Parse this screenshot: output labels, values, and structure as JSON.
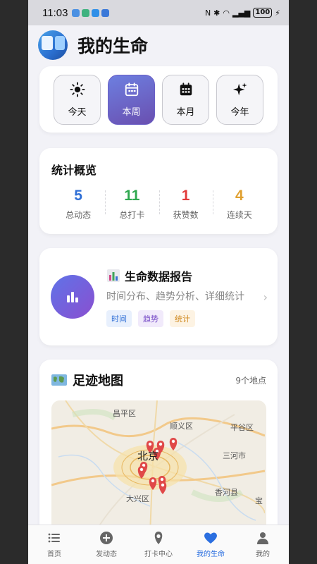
{
  "status_bar": {
    "time": "11:03",
    "battery": "100"
  },
  "header": {
    "title": "我的生命"
  },
  "periods": [
    {
      "label": "今天",
      "icon": "sun-icon",
      "active": false
    },
    {
      "label": "本周",
      "icon": "calendar-icon",
      "active": true
    },
    {
      "label": "本月",
      "icon": "calendar-grid-icon",
      "active": false
    },
    {
      "label": "今年",
      "icon": "sparkles-icon",
      "active": false
    }
  ],
  "stats": {
    "title": "统计概览",
    "items": [
      {
        "value": "5",
        "label": "总动态",
        "color": "#2f6fd6"
      },
      {
        "value": "11",
        "label": "总打卡",
        "color": "#2fa84f"
      },
      {
        "value": "1",
        "label": "获赞数",
        "color": "#e23b3b"
      },
      {
        "value": "4",
        "label": "连续天",
        "color": "#e0a030"
      }
    ]
  },
  "report": {
    "icon": "bar-chart-icon",
    "title": "生命数据报告",
    "description": "时间分布、趋势分析、详细统计",
    "tags": [
      {
        "label": "时间",
        "color": "#2f6fd6",
        "bg": "#e8f0fd"
      },
      {
        "label": "趋势",
        "color": "#7a4fc8",
        "bg": "#f1eafb"
      },
      {
        "label": "统计",
        "color": "#d08a20",
        "bg": "#fdf3e3"
      }
    ]
  },
  "map": {
    "title": "足迹地图",
    "count": "9个地点",
    "labels": {
      "changping": "昌平区",
      "shunyi": "顺义区",
      "pinggu": "平谷区",
      "beijing": "北京",
      "sanhe": "三河市",
      "xianghe": "香河县",
      "daxing": "大兴区",
      "bao": "宝"
    }
  },
  "tabbar": [
    {
      "label": "首页",
      "icon": "list-icon",
      "active": false
    },
    {
      "label": "发动态",
      "icon": "add-circle-icon",
      "active": false
    },
    {
      "label": "打卡中心",
      "icon": "location-pin-icon",
      "active": false
    },
    {
      "label": "我的生命",
      "icon": "heart-icon",
      "active": true
    },
    {
      "label": "我的",
      "icon": "person-icon",
      "active": false
    }
  ]
}
